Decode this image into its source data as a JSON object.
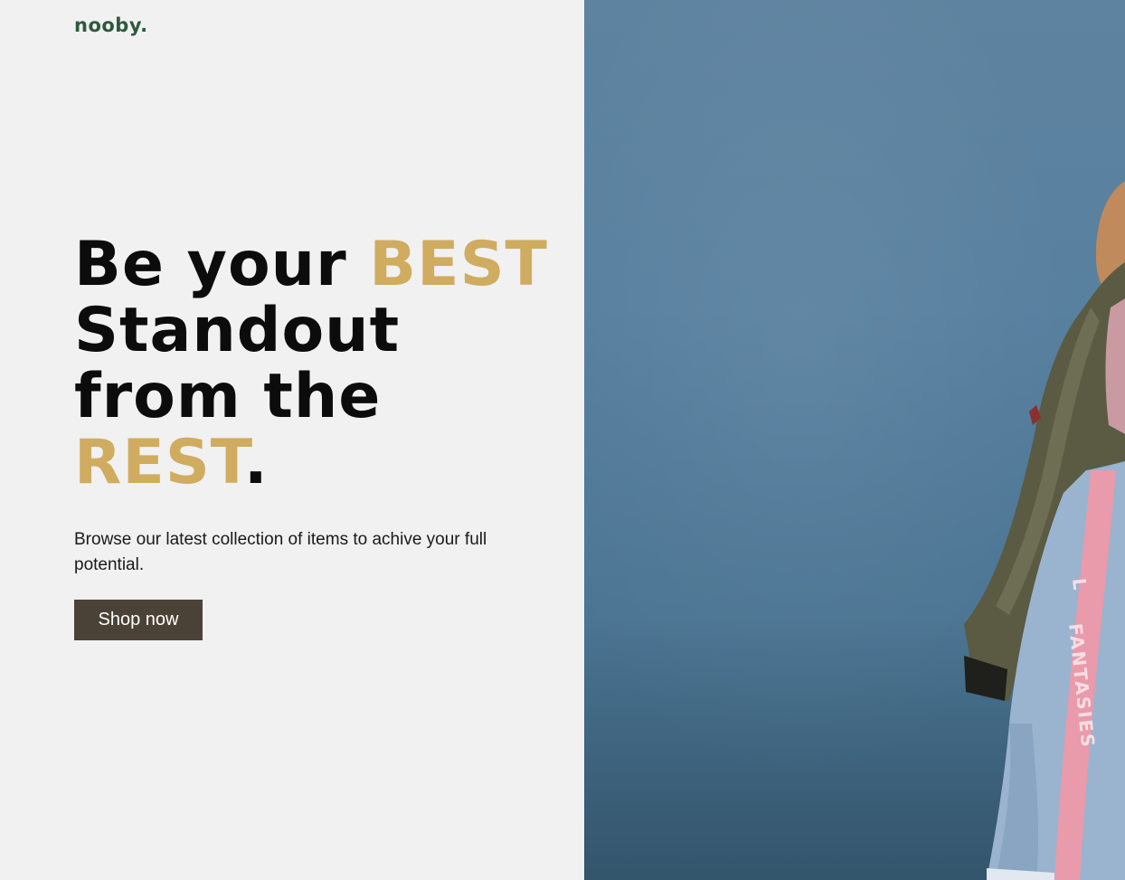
{
  "brand": {
    "logo": "nooby."
  },
  "hero": {
    "headline": {
      "line1_plain": "Be your ",
      "line1_accent": "BEST",
      "line2": "Standout",
      "line3": "from the",
      "line4_accent": "REST",
      "line4_end": "."
    },
    "description": "Browse our latest collection of items to achive your full potential.",
    "cta_label": "Shop now"
  },
  "image": {
    "jacket_text": "FANTASIES",
    "jacket_text_partial": "L"
  },
  "colors": {
    "background": "#f1f1f1",
    "accent_gold": "#cfac5f",
    "logo_green": "#2e5a3c",
    "button_bg": "#4b4237",
    "photo_bg": "#58809f",
    "stripe_pink": "#e99aab"
  }
}
